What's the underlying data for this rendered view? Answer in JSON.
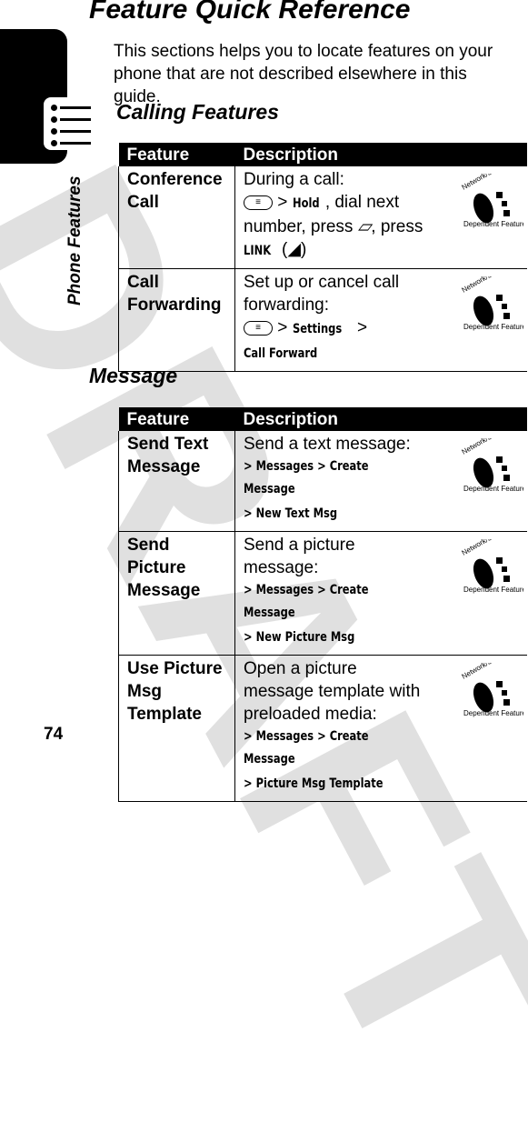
{
  "page": {
    "title": "Feature Quick Reference",
    "intro": "This sections helps you to locate features on your phone that are not described elsewhere in this guide.",
    "side_label": "Phone Features",
    "page_number": "74",
    "watermark": "DRAFT",
    "badge_icon": "network-subscription-dependent-feature-icon",
    "badge_text_top": "Network / Subscription",
    "badge_text_bottom": "Dependent Feature"
  },
  "sections": [
    {
      "title": "Calling Features",
      "headers": [
        "Feature",
        "Description"
      ],
      "rows": [
        {
          "feature": "Conference Call",
          "desc": [
            "During a call:"
          ],
          "cmd_lines": [],
          "custom": "conference"
        },
        {
          "feature": "Call Forwarding",
          "desc": [
            "Set up or cancel call forwarding:"
          ],
          "custom": "forward"
        }
      ]
    },
    {
      "title": "Message",
      "headers": [
        "Feature",
        "Description"
      ],
      "rows": [
        {
          "feature": "Send Text Message",
          "desc": [
            "Send a text message:"
          ],
          "cmd_lines": [
            "> Messages > Create Message",
            "> New Text Msg"
          ]
        },
        {
          "feature": "Send Picture Message",
          "desc": [
            "Send a picture message:"
          ],
          "cmd_lines": [
            "> Messages > Create Message",
            "> New Picture Msg"
          ]
        },
        {
          "feature": "Use Picture Msg Template",
          "desc": [
            "Open a picture message template with preloaded media:"
          ],
          "cmd_lines": [
            "> Messages > Create Message",
            "> Picture Msg Template"
          ]
        }
      ]
    }
  ],
  "conference": {
    "hold": "Hold",
    "mid": ", dial next number, press ",
    "press2": ", press ",
    "link": "LINK"
  },
  "forward": {
    "settings": "Settings",
    "call_forward": "Call Forward"
  }
}
